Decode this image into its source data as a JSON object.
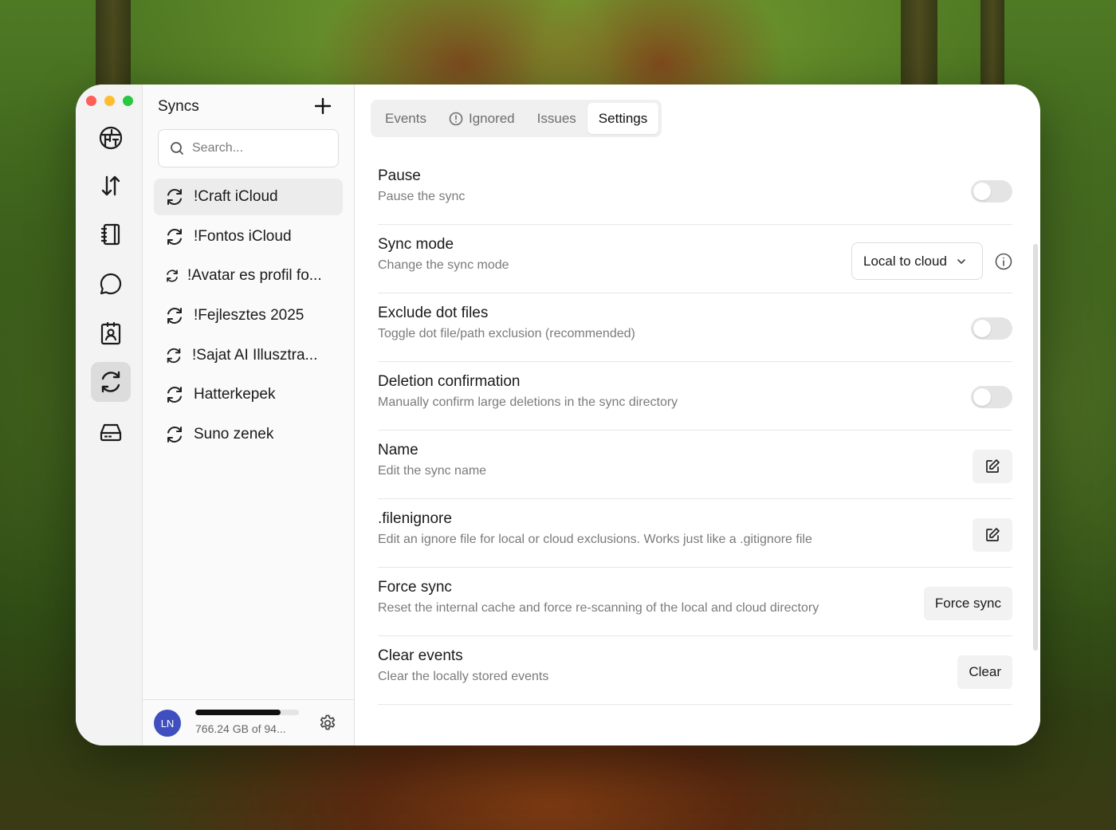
{
  "rail": {
    "items": [
      {
        "icon": "brand-logo-icon"
      },
      {
        "icon": "transfer-arrows-icon"
      },
      {
        "icon": "notebook-icon"
      },
      {
        "icon": "chat-bubble-icon"
      },
      {
        "icon": "contact-card-icon"
      },
      {
        "icon": "sync-icon",
        "active": true
      },
      {
        "icon": "drive-icon"
      }
    ]
  },
  "list": {
    "title": "Syncs",
    "search_placeholder": "Search...",
    "items": [
      {
        "label": "!Craft iCloud",
        "active": true
      },
      {
        "label": "!Fontos iCloud"
      },
      {
        "label": "!Avatar es profil fo..."
      },
      {
        "label": "!Fejlesztes 2025"
      },
      {
        "label": "!Sajat AI Illusztra..."
      },
      {
        "label": "Hatterkepek"
      },
      {
        "label": "Suno zenek"
      }
    ]
  },
  "footer": {
    "avatar_initials": "LN",
    "storage_text": "766.24 GB of 94...",
    "storage_fraction": 0.82
  },
  "tabs": [
    {
      "label": "Events"
    },
    {
      "label": "Ignored",
      "icon": "alert-circle-icon"
    },
    {
      "label": "Issues"
    },
    {
      "label": "Settings",
      "active": true
    }
  ],
  "settings": {
    "pause": {
      "title": "Pause",
      "desc": "Pause the sync",
      "enabled": false
    },
    "sync_mode": {
      "title": "Sync mode",
      "desc": "Change the sync mode",
      "value": "Local to cloud"
    },
    "exclude_dot": {
      "title": "Exclude dot files",
      "desc": "Toggle dot file/path exclusion (recommended)",
      "enabled": false
    },
    "deletion": {
      "title": "Deletion confirmation",
      "desc": "Manually confirm large deletions in the sync directory",
      "enabled": false
    },
    "name": {
      "title": "Name",
      "desc": "Edit the sync name"
    },
    "filenignore": {
      "title": ".filenignore",
      "desc": "Edit an ignore file for local or cloud exclusions. Works just like a .gitignore file"
    },
    "force_sync": {
      "title": "Force sync",
      "desc": "Reset the internal cache and force re-scanning of the local and cloud directory",
      "button": "Force sync"
    },
    "clear_events": {
      "title": "Clear events",
      "desc": "Clear the locally stored events",
      "button": "Clear"
    }
  },
  "colors": {
    "close": "#ff5f57",
    "minimize": "#febc2e",
    "zoom": "#28c840",
    "avatar": "#3f4fc0"
  }
}
